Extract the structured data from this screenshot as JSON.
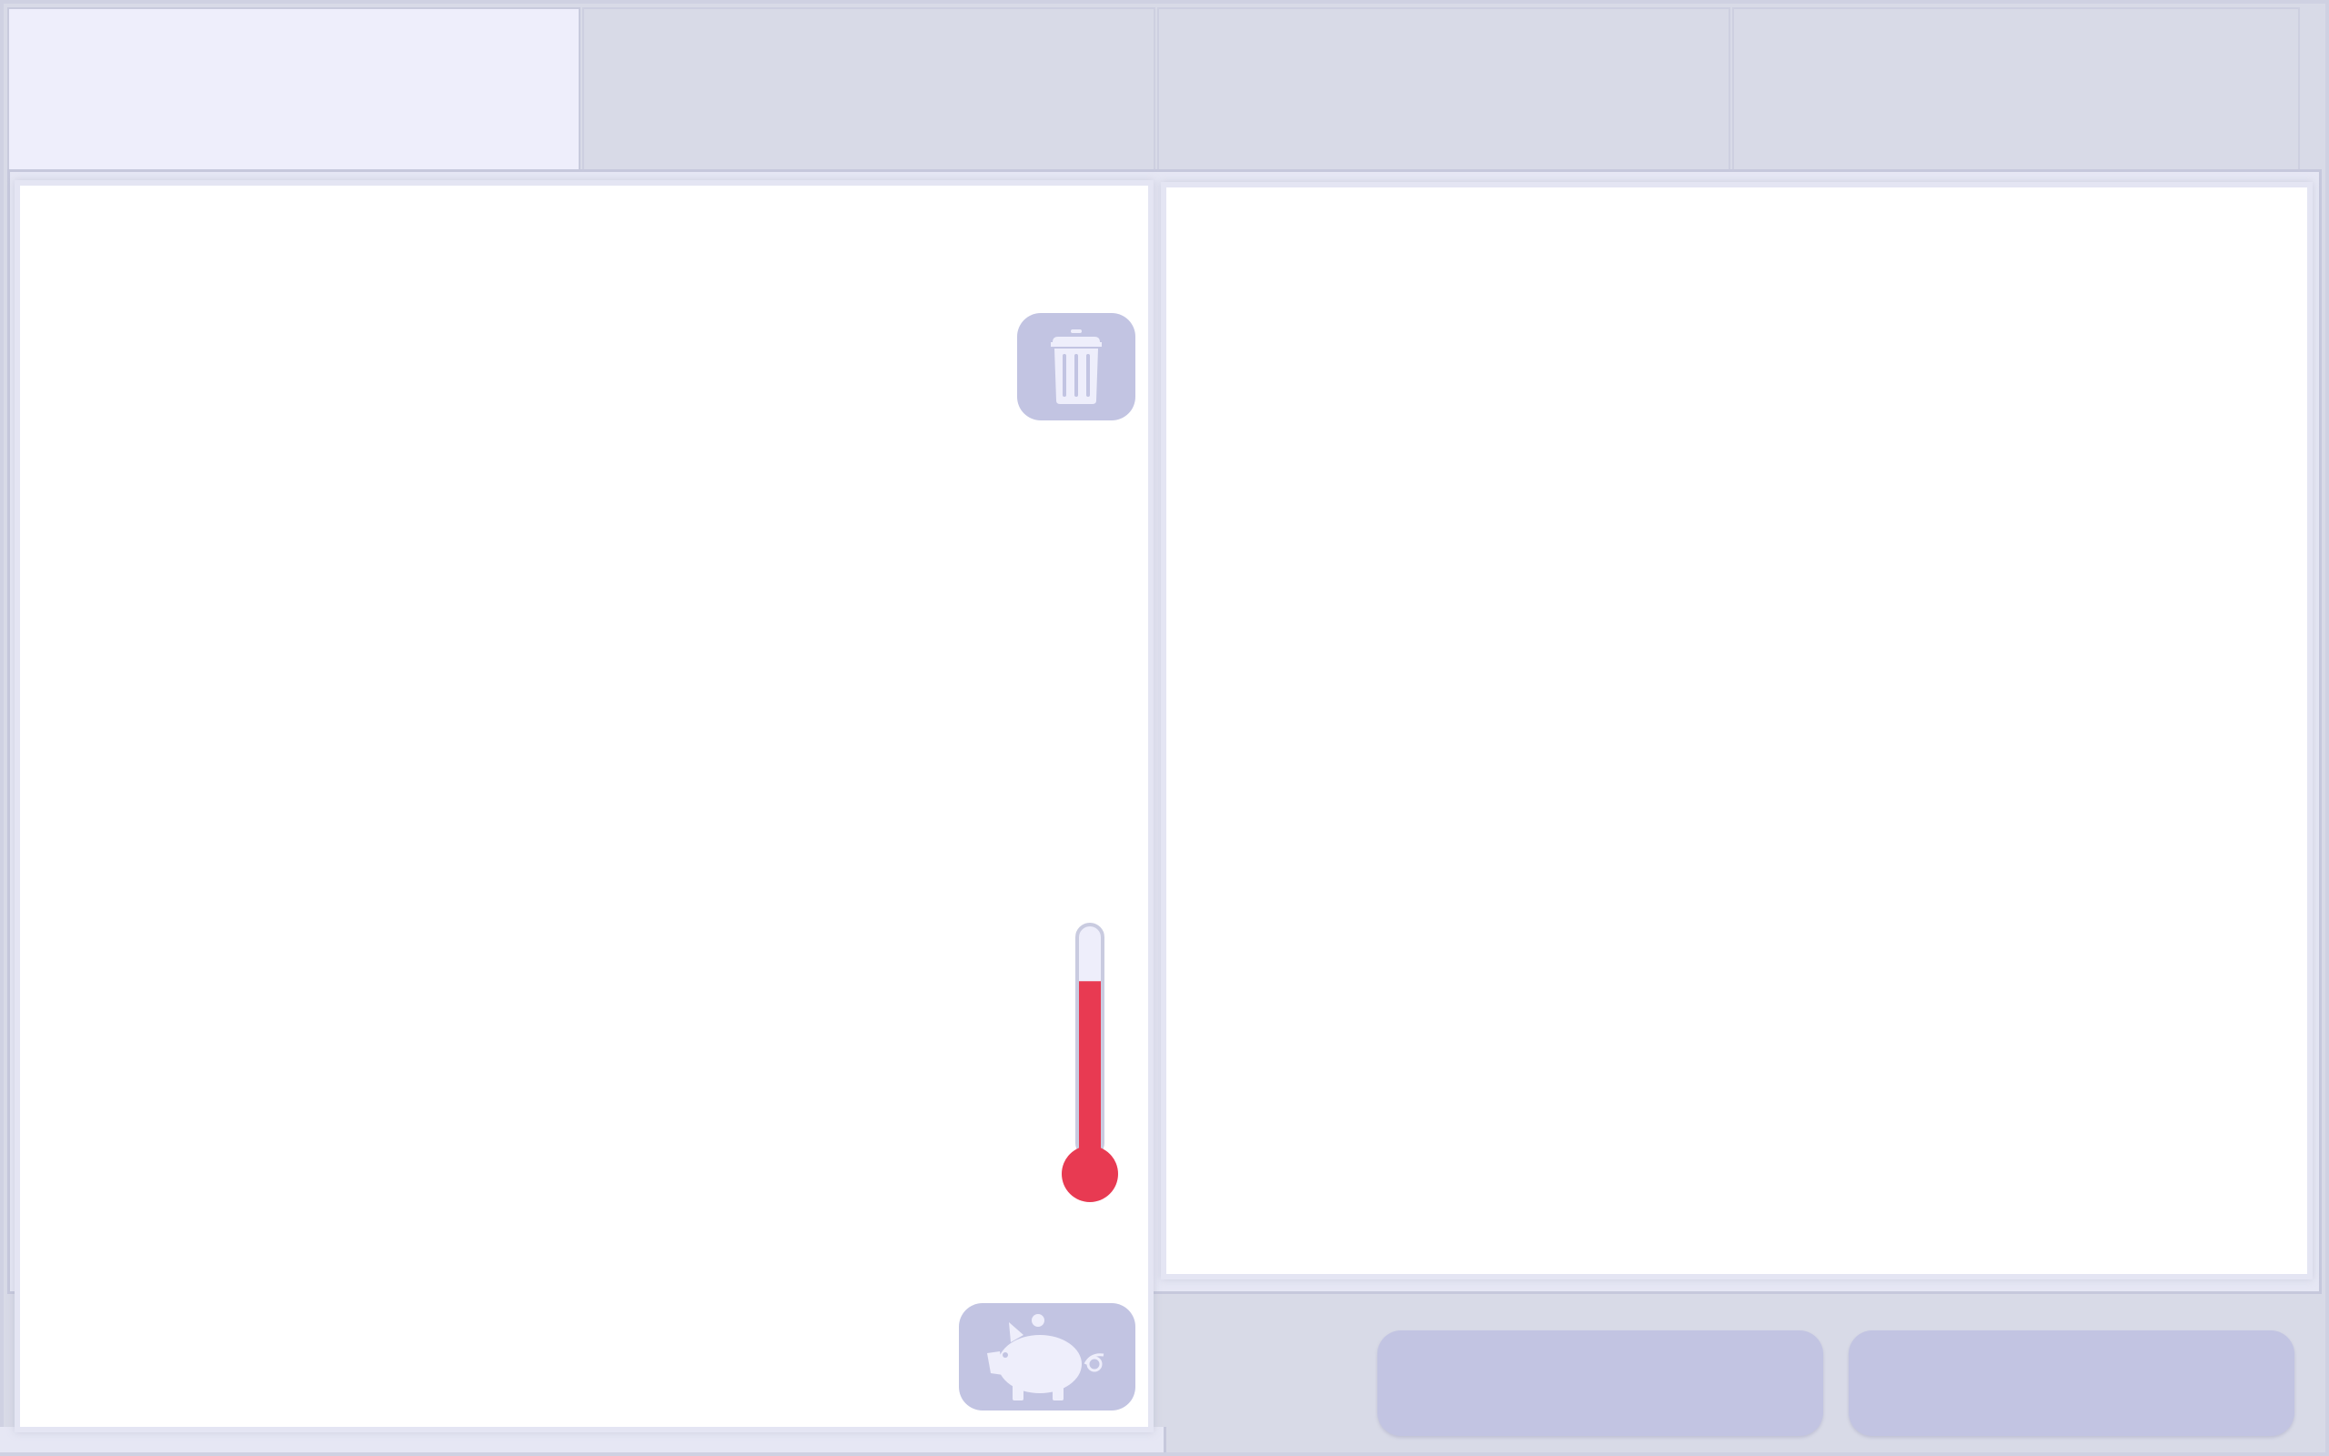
{
  "tabs": [
    {
      "label": "",
      "active": true
    },
    {
      "label": "",
      "active": false
    },
    {
      "label": "",
      "active": false
    },
    {
      "label": "",
      "active": false
    }
  ],
  "icons": {
    "trash": "trash-icon",
    "piggy_bank": "piggy-bank-icon",
    "thermometer": "thermometer-icon"
  },
  "thermometer": {
    "fill_fraction": 0.77
  },
  "colors": {
    "background": "#d8dae7",
    "tile": "#c2c4e2",
    "icon_fill": "#eeeefb",
    "mercury": "#e83a52",
    "panel": "#ffffff"
  },
  "buttons": [
    {
      "label": ""
    },
    {
      "label": ""
    }
  ]
}
